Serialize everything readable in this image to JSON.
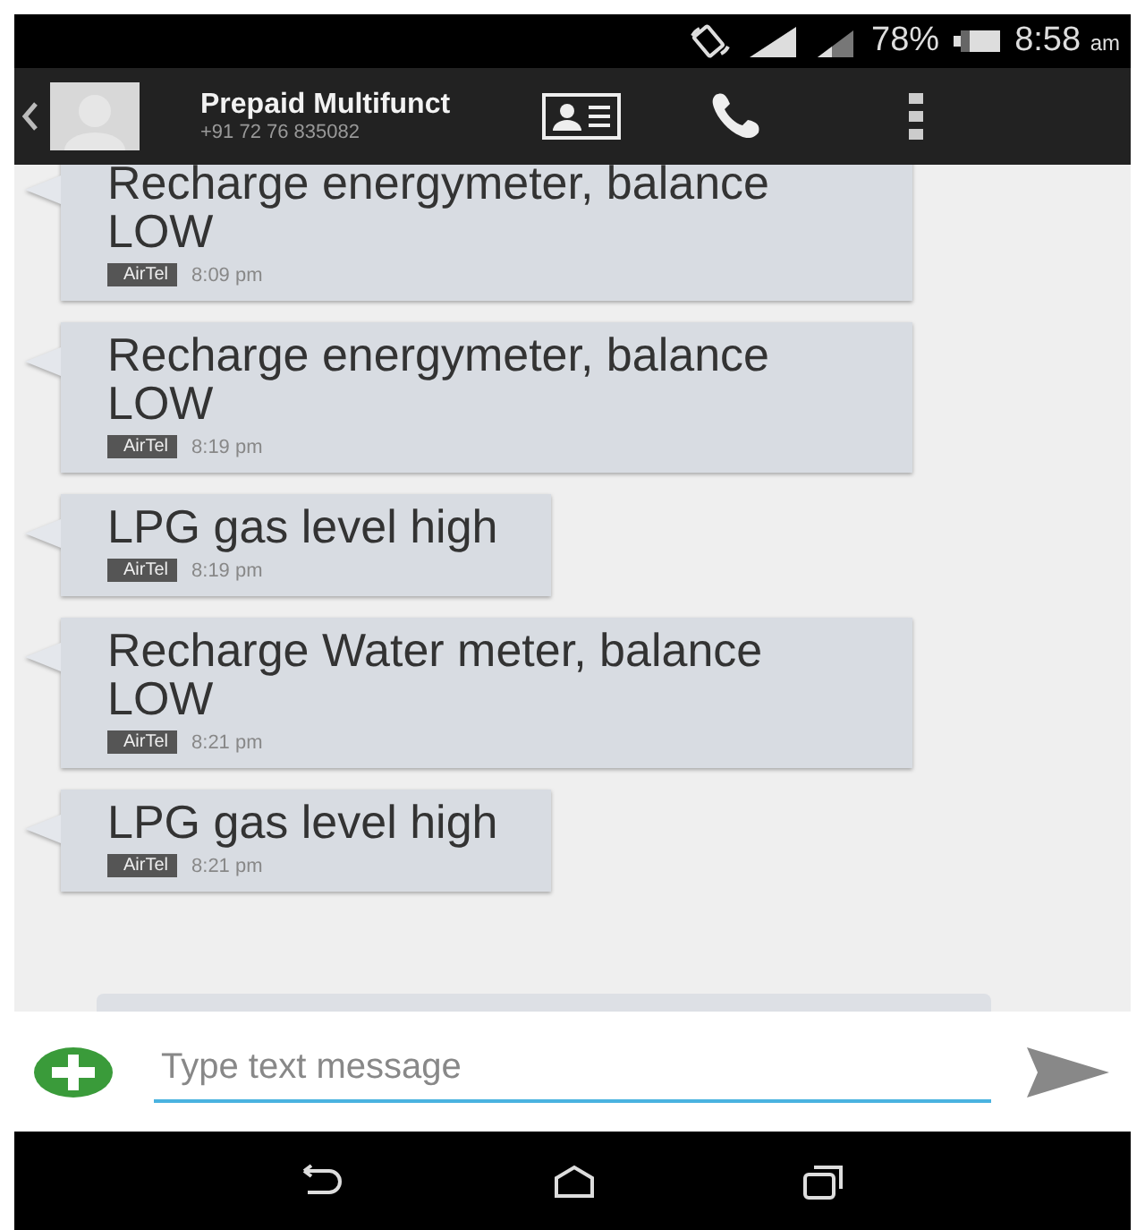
{
  "status_bar": {
    "battery": "78%",
    "time": "8:58",
    "meridiem": "am"
  },
  "header": {
    "title": "Prepaid Multifunct",
    "number": "+91 72 76 835082"
  },
  "messages": [
    {
      "text": "Recharge energymeter, balance LOW",
      "sender": "AirTel",
      "time": "8:09 pm"
    },
    {
      "text": "Recharge energymeter, balance LOW",
      "sender": "AirTel",
      "time": "8:19 pm"
    },
    {
      "text": "LPG gas level high",
      "sender": "AirTel",
      "time": "8:19 pm"
    },
    {
      "text": "Recharge Water meter, balance LOW",
      "sender": "AirTel",
      "time": "8:21 pm"
    },
    {
      "text": "LPG gas level high",
      "sender": "AirTel",
      "time": "8:21 pm"
    }
  ],
  "compose": {
    "placeholder": "Type text message"
  }
}
